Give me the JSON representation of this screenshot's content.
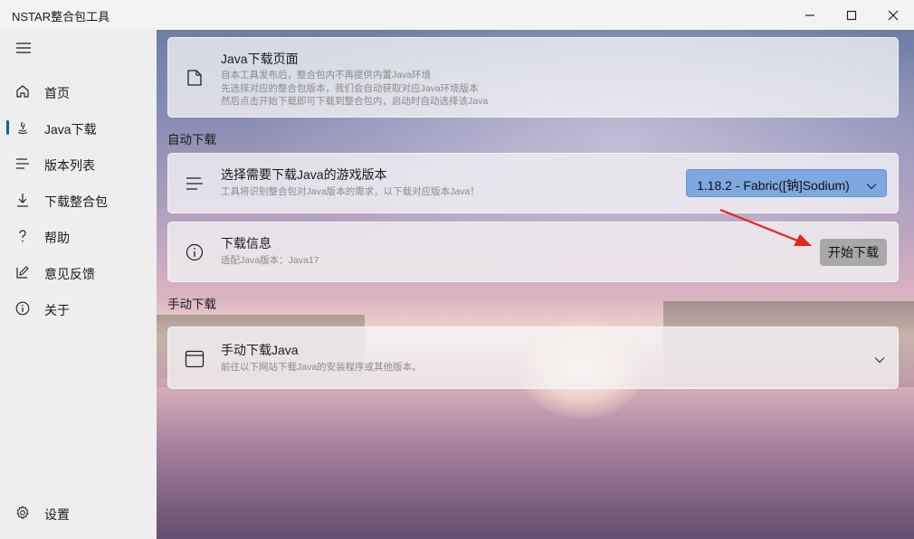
{
  "window": {
    "title": "NSTAR整合包工具",
    "controls": [
      "minimize-icon",
      "maximize-icon",
      "close-icon"
    ]
  },
  "sidebar": {
    "menu_icon": "hamburger-icon",
    "items": [
      {
        "label": "首页",
        "icon": "home-icon",
        "selected": false
      },
      {
        "label": "Java下载",
        "icon": "java-icon",
        "selected": true
      },
      {
        "label": "版本列表",
        "icon": "list-icon",
        "selected": false
      },
      {
        "label": "下载整合包",
        "icon": "download-icon",
        "selected": false
      },
      {
        "label": "帮助",
        "icon": "question-icon",
        "selected": false
      },
      {
        "label": "意见反馈",
        "icon": "feedback-icon",
        "selected": false
      },
      {
        "label": "关于",
        "icon": "info-icon",
        "selected": false
      }
    ],
    "settings": {
      "label": "设置",
      "icon": "gear-icon"
    }
  },
  "main": {
    "header_card": {
      "icon": "document-icon",
      "title": "Java下载页面",
      "lines": [
        "自本工具发布后，整合包内不再提供内置Java环境",
        "先选择对应的整合包版本，我们会自动获取对应Java环境版本",
        "然后点击开始下载即可下载到整合包内，启动时自动选择该Java"
      ]
    },
    "auto_section": {
      "label": "自动下载",
      "version_card": {
        "icon": "lines-icon",
        "title": "选择需要下载Java的游戏版本",
        "desc": "工具将识别整合包对Java版本的需求，以下载对应版本Java！",
        "selected_version": "1.18.2 - Fabric([钠]Sodium)"
      },
      "info_card": {
        "icon": "info-icon",
        "title": "下载信息",
        "desc": "适配Java版本：Java17",
        "button_label": "开始下载"
      }
    },
    "manual_section": {
      "label": "手动下载",
      "card": {
        "icon": "window-icon",
        "title": "手动下载Java",
        "desc": "前往以下网站下载Java的安装程序或其他版本。"
      }
    },
    "annotation_color": "#e8231f",
    "accent_color": "#0063b1",
    "combo_color": "#7fa7e0"
  }
}
